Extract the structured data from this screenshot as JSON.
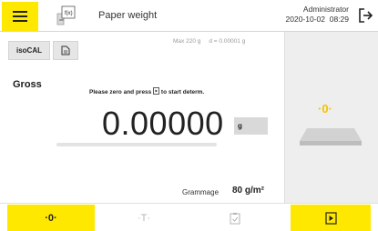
{
  "header": {
    "app_name": "Paper weight",
    "app_icon_label": "f(x)",
    "user": "Administrator",
    "datetime": "2020-10-02  08:29"
  },
  "toolbar_top": {
    "isocal_label": "isoCAL"
  },
  "capacity": "Max 220 g     d = 0.00001 g",
  "main": {
    "mode_label": "Gross",
    "instruction_pre": "Please zero and press",
    "instruction_post": "to start determ.",
    "weight_value": "0.00000",
    "unit": "g",
    "progress_fraction": 0.0,
    "grammage_label": "Grammage",
    "grammage_value": "80 g/m²"
  },
  "right_panel": {
    "zero_indicator": "·0·"
  },
  "bottom_toolbar": {
    "zero_label": "·0·",
    "tare_label": "·T·"
  },
  "colors": {
    "accent": "#ffe800",
    "zero_indicator": "#f0c400",
    "disabled": "#b5b5b5"
  }
}
